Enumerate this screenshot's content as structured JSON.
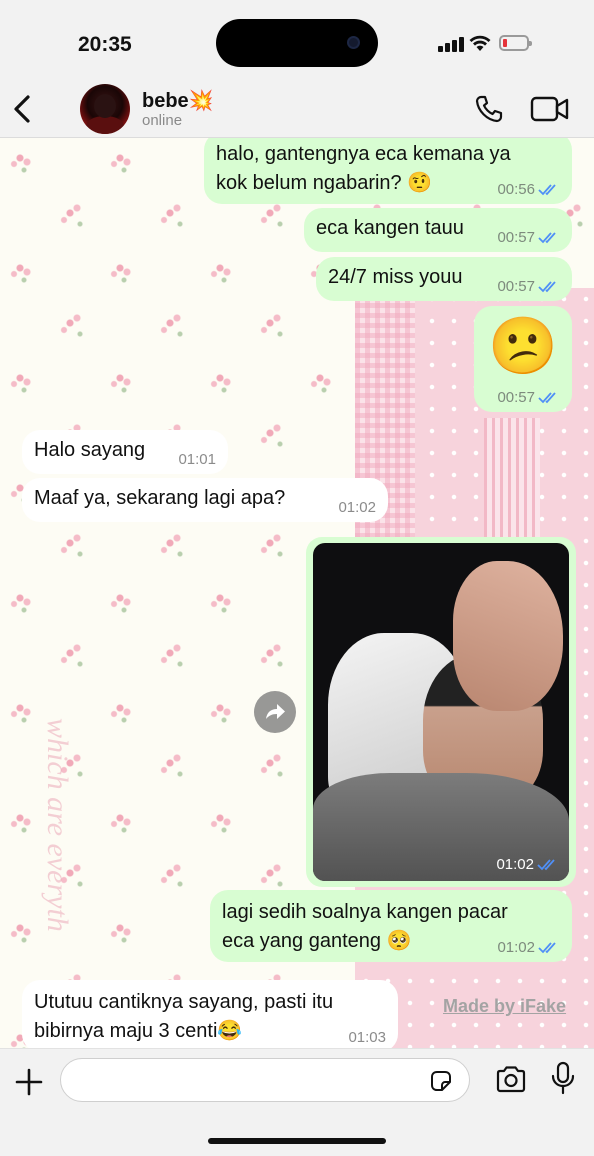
{
  "status_bar": {
    "time": "20:35"
  },
  "header": {
    "contact_name": "bebe💥",
    "contact_status": "online"
  },
  "messages": [
    {
      "id": 1,
      "direction": "outgoing",
      "lines": [
        "halo, gantengnya eca kemana ya",
        "kok belum ngabarin? 🤨"
      ],
      "time": "00:56",
      "read": true
    },
    {
      "id": 2,
      "direction": "outgoing",
      "lines": [
        "eca kangen tauu"
      ],
      "time": "00:57",
      "read": true
    },
    {
      "id": 3,
      "direction": "outgoing",
      "lines": [
        "24/7 miss youu"
      ],
      "time": "00:57",
      "read": true
    },
    {
      "id": 4,
      "direction": "outgoing",
      "emoji": "😕",
      "time": "00:57",
      "read": true
    },
    {
      "id": 5,
      "direction": "incoming",
      "lines": [
        "Halo sayang"
      ],
      "time": "01:01"
    },
    {
      "id": 6,
      "direction": "incoming",
      "lines": [
        "Maaf ya, sekarang lagi apa?"
      ],
      "time": "01:02"
    },
    {
      "id": 7,
      "direction": "outgoing",
      "type": "photo",
      "time": "01:02",
      "read": true
    },
    {
      "id": 8,
      "direction": "outgoing",
      "lines": [
        "lagi sedih soalnya kangen pacar",
        "eca yang ganteng 🥺"
      ],
      "time": "01:02",
      "read": true
    },
    {
      "id": 9,
      "direction": "incoming",
      "lines": [
        "Ututuu cantiknya sayang, pasti itu",
        "bibirnya maju 3 centi😂"
      ],
      "time": "01:03"
    }
  ],
  "wallpaper_text": "which are everyth",
  "watermark_label": "Made by iFake",
  "colors": {
    "outgoing_bubble": "#d8fdd2",
    "incoming_bubble": "#ffffff",
    "read_tick": "#4f8ff7",
    "battery_low": "#e5333a"
  },
  "icons": [
    "back-chevron-icon",
    "phone-icon",
    "video-camera-icon",
    "plus-icon",
    "sticker-icon",
    "camera-icon",
    "microphone-icon",
    "forward-icon"
  ]
}
